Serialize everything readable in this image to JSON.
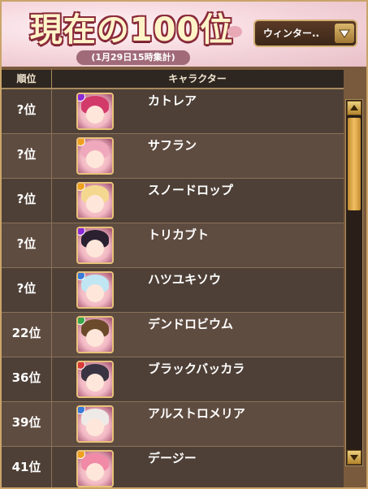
{
  "header": {
    "title": "現在の100位",
    "subtitle": "(1月29日15時集計)",
    "dropdown_label": "ウィンター..",
    "dropdown_icon": "chevron-down-icon"
  },
  "table": {
    "columns": [
      "順位",
      "キャラクター"
    ],
    "rows": [
      {
        "rank": "?位",
        "name": "カトレア",
        "hair": "#d23a6a",
        "orb": "#8a2ad8"
      },
      {
        "rank": "?位",
        "name": "サフラン",
        "hair": "#f0a8bc",
        "orb": "#f0a020"
      },
      {
        "rank": "?位",
        "name": "スノードロップ",
        "hair": "#f4d890",
        "orb": "#f0a020"
      },
      {
        "rank": "?位",
        "name": "トリカブト",
        "hair": "#2a2030",
        "orb": "#8a2ad8"
      },
      {
        "rank": "?位",
        "name": "ハツユキソウ",
        "hair": "#bfe6f2",
        "orb": "#3a7ad8"
      },
      {
        "rank": "22位",
        "name": "デンドロビウム",
        "hair": "#6a4a2a",
        "orb": "#3aa84a"
      },
      {
        "rank": "36位",
        "name": "ブラックバッカラ",
        "hair": "#3a3442",
        "orb": "#d83a3a"
      },
      {
        "rank": "39位",
        "name": "アルストロメリア",
        "hair": "#eeeae8",
        "orb": "#3a7ad8"
      },
      {
        "rank": "41位",
        "name": "デージー",
        "hair": "#f08aa6",
        "orb": "#f0a020"
      }
    ]
  },
  "scrollbar": {
    "position_fraction": 0.0
  }
}
